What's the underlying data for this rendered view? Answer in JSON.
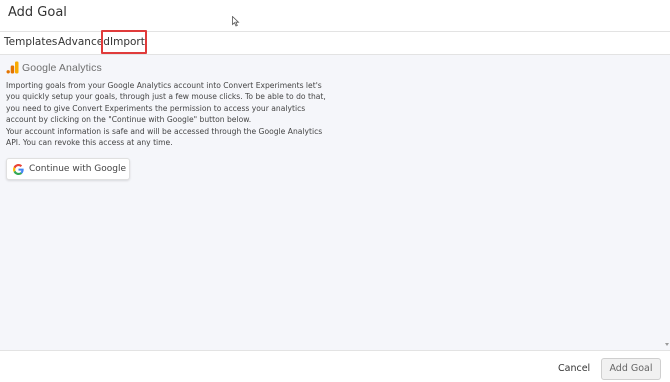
{
  "header": {
    "title": "Add Goal"
  },
  "tabs": [
    {
      "label": "Templates"
    },
    {
      "label": "Advanced"
    },
    {
      "label": "Import"
    }
  ],
  "active_tab": "Import",
  "import": {
    "provider_name": "Google Analytics",
    "description": [
      "Importing goals from your Google Analytics account into Convert Experiments let's",
      "you quickly setup your goals, through just a few mouse clicks. To be able to do that,",
      "you need to give Convert Experiments the permission to access your analytics",
      "account by clicking on the \"Continue with Google\" button below.",
      "Your account information is safe and will be accessed through the Google Analytics",
      "API. You can revoke this access at any time."
    ],
    "google_button_label": "Continue with Google"
  },
  "footer": {
    "cancel_label": "Cancel",
    "add_goal_label": "Add Goal"
  },
  "colors": {
    "highlight_border": "#e03b3b",
    "content_background": "#f5f6fa",
    "ga_orange": "#f9ab00",
    "ga_dark_orange": "#e37400"
  },
  "icons": [
    "google-analytics-logo-icon",
    "google-g-icon",
    "mouse-cursor-icon"
  ]
}
